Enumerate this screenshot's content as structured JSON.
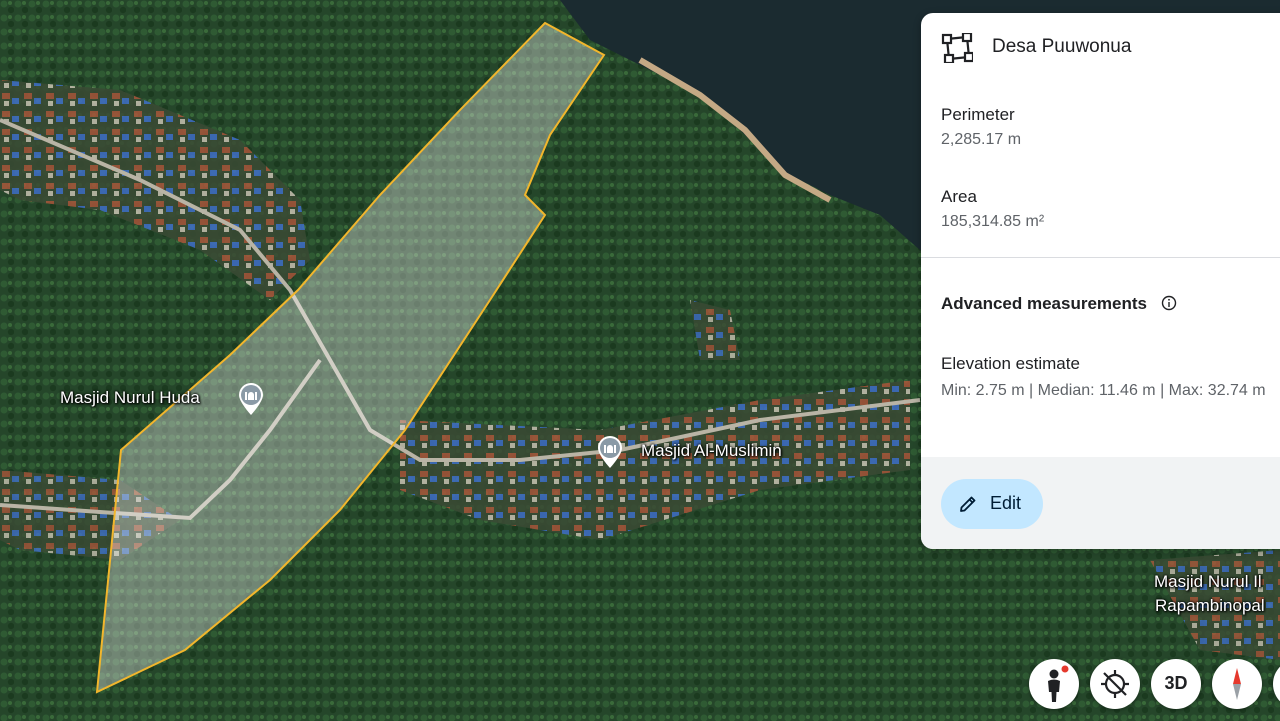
{
  "map": {
    "labels": {
      "masjid_nurul_huda": "Masjid Nurul Huda",
      "masjid_al_muslimin": "Masjid Al-Muslimin",
      "masjid_nurul_il": "Masjid Nurul Il",
      "rapambinopal": "Rapambinopal"
    },
    "colors": {
      "polygon_stroke": "#f2b62c",
      "polygon_fill": "rgba(255,255,255,0.35)",
      "forest": "#1f3a22",
      "water": "#1a2a2e"
    }
  },
  "panel": {
    "title": "Desa Puuwonua",
    "title_icon": "polygon-icon",
    "perimeter_label": "Perimeter",
    "perimeter_value": "2,285.17 m",
    "area_label": "Area",
    "area_value": "185,314.85 m²",
    "advanced_label": "Advanced measurements",
    "advanced_icon": "info-icon",
    "elevation_label": "Elevation estimate",
    "elevation_value": "Min: 2.75 m | Median: 11.46 m | Max: 32.74 m",
    "edit_label": "Edit",
    "edit_icon": "pencil-icon",
    "edit_color": "#c2e7ff"
  },
  "controls": {
    "pegman_icon": "pegman-icon",
    "location_icon": "location-off-icon",
    "three_d_label": "3D",
    "compass_icon": "compass-icon"
  }
}
